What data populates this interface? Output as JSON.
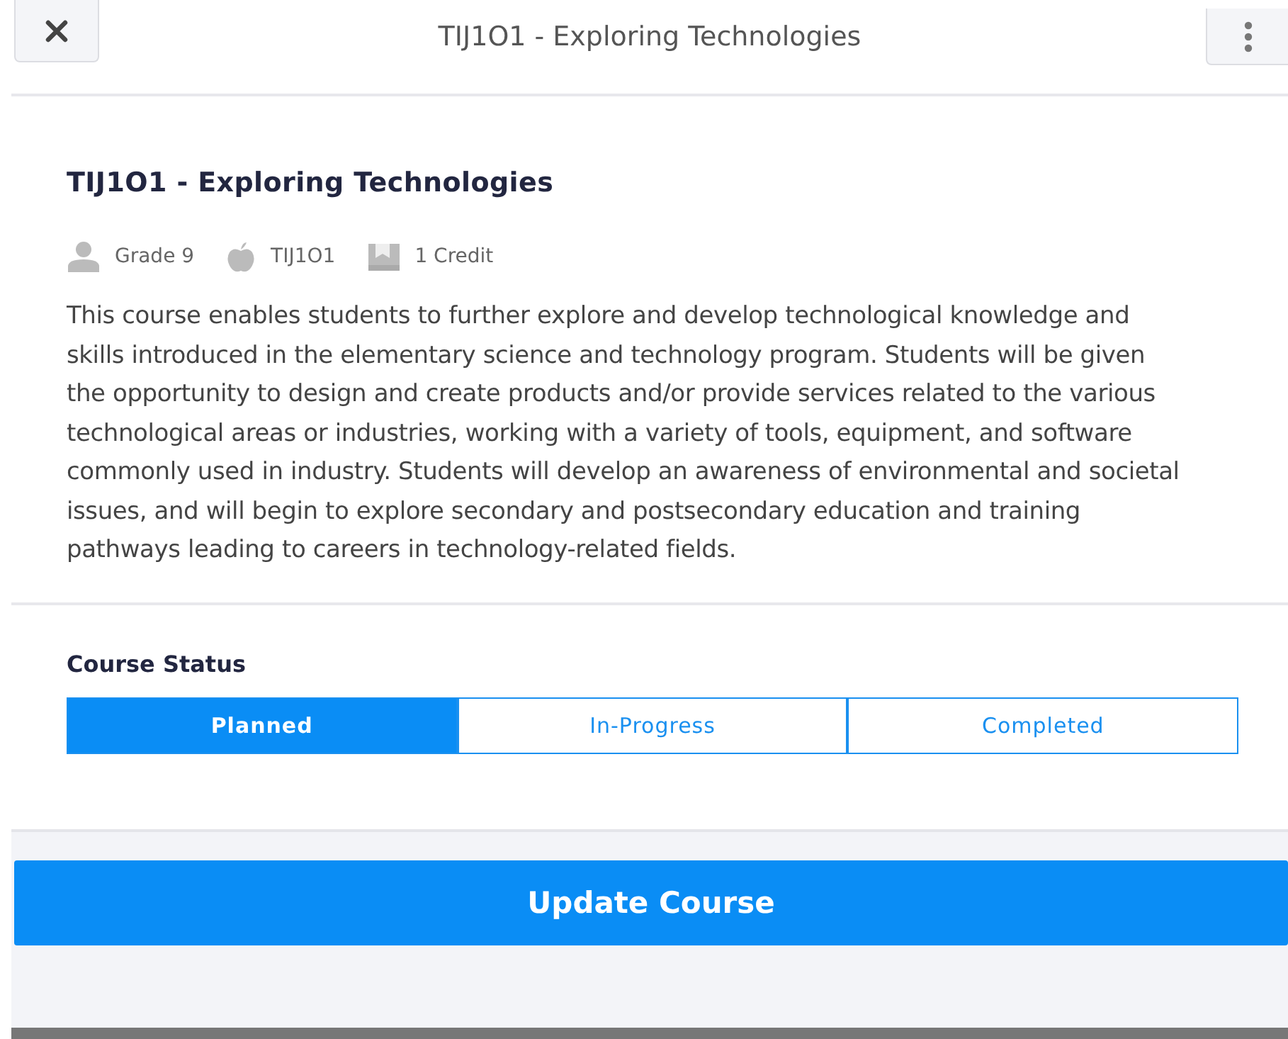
{
  "header": {
    "title": "TIJ1O1 - Exploring Technologies"
  },
  "course": {
    "title": "TIJ1O1 - Exploring Technologies",
    "meta": [
      {
        "kind": "grade",
        "text": "Grade 9"
      },
      {
        "kind": "code",
        "text": "TIJ1O1"
      },
      {
        "kind": "credit",
        "text": "1 Credit"
      }
    ],
    "description": "This course enables students to further explore and develop technological knowledge and skills introduced in the elementary science and technology program. Students will be given the opportunity to design and create products and/or provide services related to the various technological areas or industries, working with a variety of tools, equipment, and software commonly used in industry. Students will develop an awareness of environmental and societal issues, and will begin to explore secondary and postsecondary education and training pathways leading to careers in technology-related fields."
  },
  "status": {
    "label": "Course Status",
    "options": [
      {
        "label": "Planned",
        "selected": true
      },
      {
        "label": "In-Progress",
        "selected": false
      },
      {
        "label": "Completed",
        "selected": false
      }
    ]
  },
  "footer": {
    "button": "Update Course"
  }
}
